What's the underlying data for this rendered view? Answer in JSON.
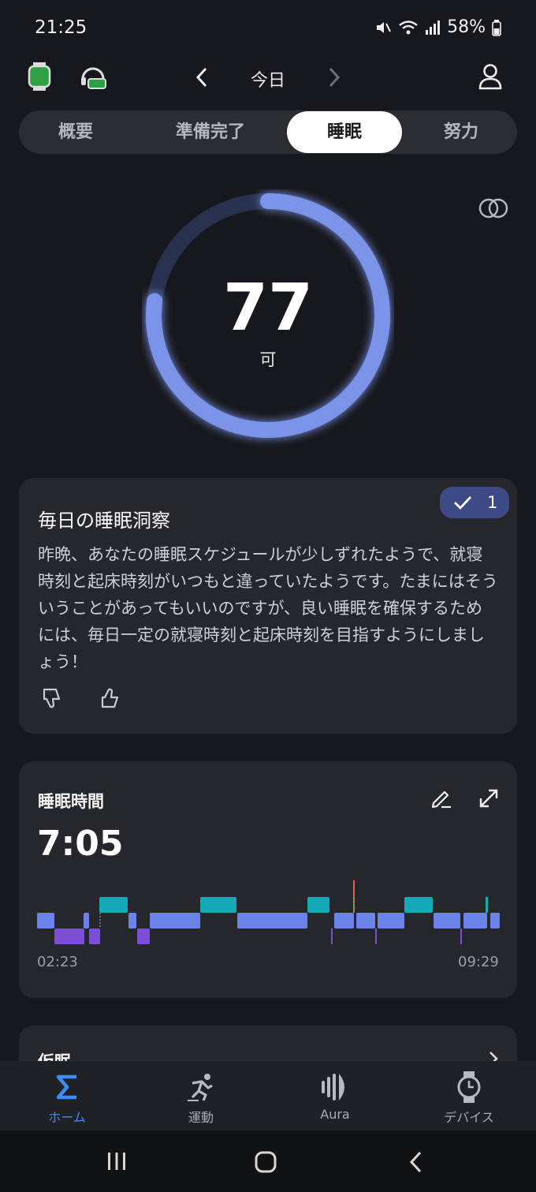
{
  "status_bar": {
    "time": "21:25",
    "battery": "58%"
  },
  "header": {
    "date": "今日"
  },
  "tabs": [
    {
      "label": "概要"
    },
    {
      "label": "準備完了"
    },
    {
      "label": "睡眠"
    },
    {
      "label": "努力"
    }
  ],
  "active_tab": "睡眠",
  "score": {
    "value": "77",
    "label": "可",
    "fraction": 0.77
  },
  "insight": {
    "title": "毎日の睡眠洞察",
    "badge_count": "1",
    "body": "昨晩、あなたの睡眠スケジュールが少しずれたようで、就寝時刻と起床時刻がいつもと違っていたようです。たまにはそういうことがあってもいいのですが、良い睡眠を確保するためには、毎日一定の就寝時刻と起床時刻を目指すようにしましょう！"
  },
  "sleep_duration": {
    "title": "睡眠時間",
    "value": "7:05",
    "start": "02:23",
    "end": "09:29"
  },
  "next_card": {
    "title": "仮眠"
  },
  "bottom_nav": [
    {
      "label": "ホーム",
      "icon": "sigma-icon"
    },
    {
      "label": "運動",
      "icon": "running-icon"
    },
    {
      "label": "Aura",
      "icon": "aura-icon"
    },
    {
      "label": "デバイス",
      "icon": "watch-icon"
    }
  ],
  "colors": {
    "accent": "#3b8cf3",
    "ring": "#7b93ea",
    "light_sleep": "#6b82e8",
    "deep_sleep": "#7b4fd3",
    "awake": "#18a9b8",
    "badge": "#3d4a86"
  }
}
